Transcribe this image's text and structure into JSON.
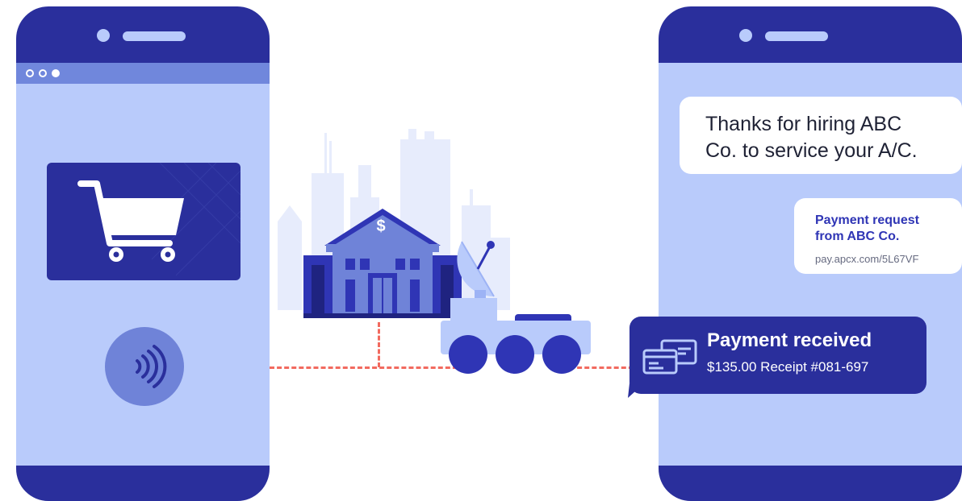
{
  "left_phone": {
    "browser_dots": 3,
    "icons": {
      "cart": "shopping-cart-icon",
      "nfc": "contactless-payment-icon"
    }
  },
  "right_phone": {
    "messages": {
      "thanks": "Thanks for hiring ABC\nCo. to service your A/C.",
      "payment_request_title": "Payment request\nfrom ABC Co.",
      "payment_request_link": "pay.apcx.com/5L67VF"
    }
  },
  "payment_received": {
    "title": "Payment received",
    "details": "$135.00 Receipt #081-697",
    "icon": "credit-cards-icon"
  },
  "scene": {
    "bank_symbol": "$",
    "icons": [
      "city-skyline-icon",
      "bank-building-icon",
      "satellite-truck-icon"
    ]
  },
  "colors": {
    "primary": "#2a2f9c",
    "screen": "#b9cbfb",
    "accent": "#6f83d8",
    "dash": "#f26a5f"
  }
}
